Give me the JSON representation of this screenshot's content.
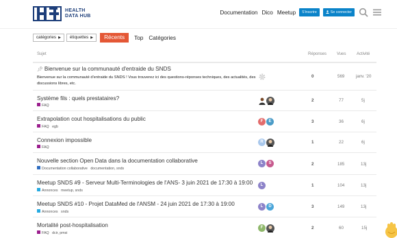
{
  "header": {
    "logo_line1": "HEALTH",
    "logo_line2": "DATA HUB",
    "nav": [
      "Documentation",
      "Dico",
      "Meetup"
    ],
    "signup_label": "S'inscrire",
    "login_label": "Se connecter",
    "search_icon": "search-icon",
    "menu_icon": "hamburger-icon",
    "accent": "#0a83c9"
  },
  "controls": {
    "categories_label": "catégories",
    "tags_label": "étiquettes",
    "tabs": [
      "Récents",
      "Top",
      "Catégories"
    ],
    "active_color": "#e45735"
  },
  "table": {
    "headers": {
      "topic": "Sujet",
      "replies": "Réponses",
      "views": "Vues",
      "activity": "Activité"
    }
  },
  "topics": [
    {
      "title": "Bienvenue sur la communauté d'entraide du SNDS",
      "pinned": true,
      "excerpt": "Bienvenue sur la communauté d'entraide du SNDS ! Vous trouverez ici des questions-réponses techniques, des actualités, des discussions libres, etc.",
      "category": "",
      "tags": "",
      "replies": "0",
      "views": "569",
      "activity": "janv. '20"
    },
    {
      "title": "Système fils : quels prestataires?",
      "category": "FAQ",
      "cat_color": "#9b1d8d",
      "tags": "",
      "replies": "2",
      "views": "77",
      "activity": "5j"
    },
    {
      "title": "Extrapolation cout hospitalisations du public",
      "category": "FAQ",
      "cat_color": "#9b1d8d",
      "tags": "egb",
      "replies": "3",
      "views": "36",
      "activity": "6j"
    },
    {
      "title": "Connexion impossible",
      "category": "FAQ",
      "cat_color": "#9b1d8d",
      "tags": "",
      "replies": "1",
      "views": "22",
      "activity": "6j"
    },
    {
      "title": "Nouvelle section Open Data dans la documentation collaborative",
      "category": "Documentation collaborative",
      "cat_color": "#2d6cc0",
      "tags": "documentation, snds",
      "replies": "2",
      "views": "185",
      "activity": "13j"
    },
    {
      "title": "Meetup SNDS #9 - Serveur Multi-Terminologies de l'ANS- 3 juin 2021 de 17:30 à 19:00",
      "category": "Annonces",
      "cat_color": "#25aae1",
      "tags": "meetup, snds",
      "replies": "1",
      "views": "104",
      "activity": "13j"
    },
    {
      "title": "Meetup SNDS #10 - Projet DataMed de l'ANSM - 24 juin 2021 de 17:30 à 19:00",
      "category": "Annonces",
      "cat_color": "#25aae1",
      "tags": "snds",
      "replies": "3",
      "views": "149",
      "activity": "13j"
    },
    {
      "title": "Mortalité post-hospitalisation",
      "category": "FAQ",
      "cat_color": "#9b1d8d",
      "tags": "dcir, pmsi",
      "replies": "2",
      "views": "60",
      "activity": "15j"
    }
  ]
}
